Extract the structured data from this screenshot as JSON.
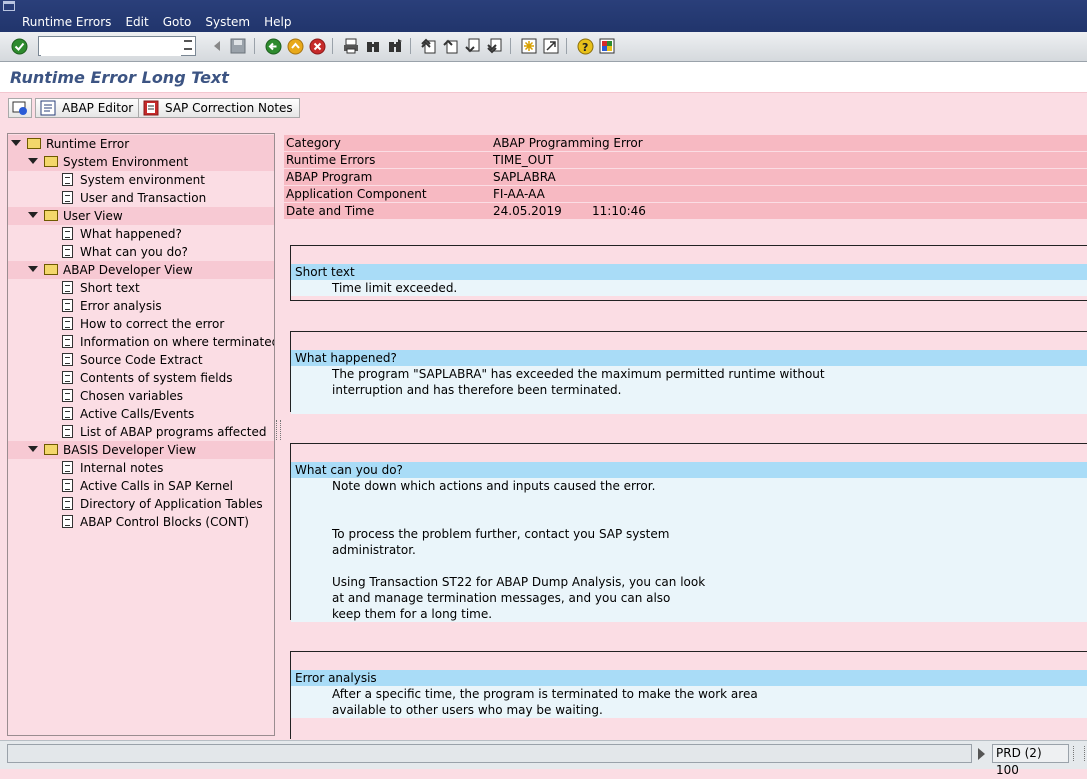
{
  "menu": [
    "Runtime Errors",
    "Edit",
    "Goto",
    "System",
    "Help"
  ],
  "toolbar": {
    "command_value": ""
  },
  "title": "Runtime Error Long Text",
  "app_buttons": {
    "abap_editor": "ABAP Editor",
    "sap_notes": "SAP Correction Notes"
  },
  "tree": {
    "root": "Runtime Error",
    "system_env": "System Environment",
    "system_env_items": [
      "System environment",
      "User and Transaction"
    ],
    "user_view": "User View",
    "user_view_items": [
      "What happened?",
      "What can you do?"
    ],
    "dev_view": "ABAP Developer View",
    "dev_view_items": [
      "Short text",
      "Error analysis",
      "How to correct the error",
      "Information on where terminated",
      "Source Code Extract",
      "Contents of system fields",
      "Chosen variables",
      "Active Calls/Events",
      "List of ABAP programs affected"
    ],
    "basis_view": "BASIS Developer View",
    "basis_view_items": [
      "Internal notes",
      "Active Calls in SAP Kernel",
      "Directory of Application Tables",
      "ABAP Control Blocks (CONT)"
    ]
  },
  "header": [
    {
      "k": "Category",
      "v": "ABAP Programming Error",
      "v2": ""
    },
    {
      "k": "Runtime Errors",
      "v": "TIME_OUT",
      "v2": ""
    },
    {
      "k": "ABAP Program",
      "v": "SAPLABRA",
      "v2": ""
    },
    {
      "k": "Application Component",
      "v": "FI-AA-AA",
      "v2": ""
    },
    {
      "k": "Date and Time",
      "v": "24.05.2019",
      "v2": "11:10:46"
    }
  ],
  "sections": [
    {
      "title": "Short text",
      "lines": [
        "Time limit exceeded."
      ]
    },
    {
      "title": "What happened?",
      "lines": [
        "The program \"SAPLABRA\" has exceeded the maximum permitted runtime without",
        "interruption and has therefore been terminated.",
        ""
      ]
    },
    {
      "title": "What can you do?",
      "lines": [
        "Note down which actions and inputs caused the error.",
        "",
        "",
        "To process the problem further, contact you SAP system",
        "administrator.",
        "",
        "Using Transaction ST22 for ABAP Dump Analysis, you can look",
        "at and manage termination messages, and you can also",
        "keep them for a long time."
      ]
    },
    {
      "title": "Error analysis",
      "lines": [
        "After a specific time, the program is terminated to make the work area",
        "available to other users who may be waiting."
      ]
    }
  ],
  "status": {
    "system": "PRD (2) 100"
  }
}
